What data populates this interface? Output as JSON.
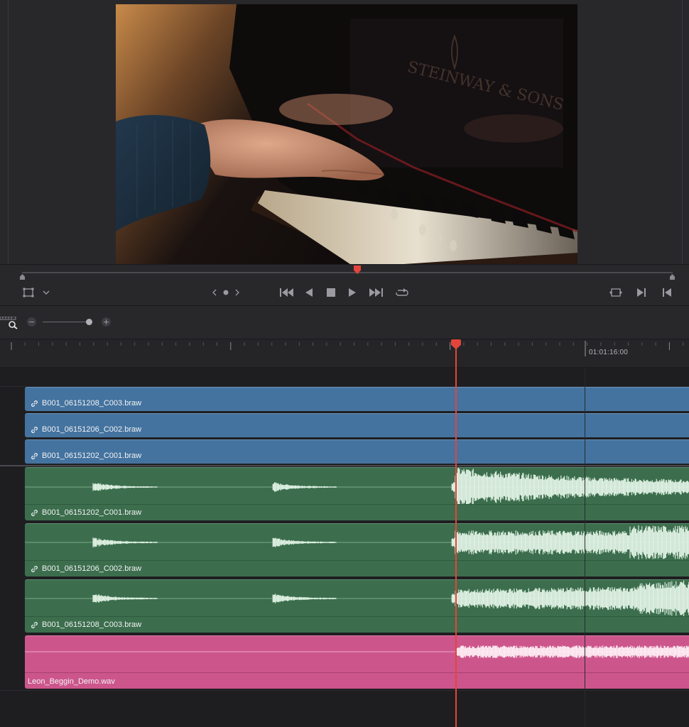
{
  "viewer": {
    "frame_description": "",
    "timecode_scrub_position": 0.52
  },
  "transport": {
    "buttons": [
      "transform",
      "dropdown",
      "prev-edit",
      "marker",
      "next-edit",
      "go-to-start",
      "step-back",
      "stop",
      "play",
      "go-to-end",
      "loop",
      "match-frame",
      "next-clip",
      "previous-clip"
    ]
  },
  "ruler": {
    "timecode": "01:01:16:00"
  },
  "zoom": {
    "level": 0.92
  },
  "tracks": {
    "video": [
      {
        "name": "B001_06151208_C003.braw"
      },
      {
        "name": "B001_06151206_C002.braw"
      },
      {
        "name": "B001_06151202_C001.braw"
      }
    ],
    "audio": [
      {
        "name": "B001_06151202_C001.braw"
      },
      {
        "name": "B001_06151206_C002.braw"
      },
      {
        "name": "B001_06151208_C003.braw"
      }
    ],
    "music": {
      "name": "Leon_Beggin_Demo.wav"
    }
  },
  "colors": {
    "video_clip": "#44739f",
    "audio_clip": "#3c6e4d",
    "music_clip": "#cc568c",
    "playhead": "#e5443a"
  }
}
